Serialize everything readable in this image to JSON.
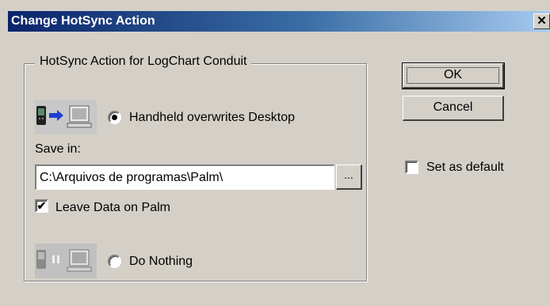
{
  "window": {
    "title": "Change HotSync Action",
    "close_glyph": "✕"
  },
  "group": {
    "legend": "HotSync Action for LogChart Conduit"
  },
  "options": {
    "handheld_overwrites": {
      "label": "Handheld overwrites Desktop",
      "selected": true,
      "icon": "handheld-to-desktop-icon"
    },
    "do_nothing": {
      "label": "Do Nothing",
      "selected": false,
      "icon": "do-nothing-sync-icon"
    }
  },
  "save_in": {
    "label": "Save in:",
    "path": "C:\\Arquivos de programas\\Palm\\",
    "browse_label": "..."
  },
  "leave_data": {
    "label": "Leave Data on Palm",
    "checked": true,
    "check_glyph": "✔"
  },
  "buttons": {
    "ok": "OK",
    "cancel": "Cancel"
  },
  "set_default": {
    "label": "Set as default",
    "checked": false
  },
  "colors": {
    "face": "#d4d0c8",
    "title_start": "#0a246a",
    "title_end": "#a6caf0"
  }
}
